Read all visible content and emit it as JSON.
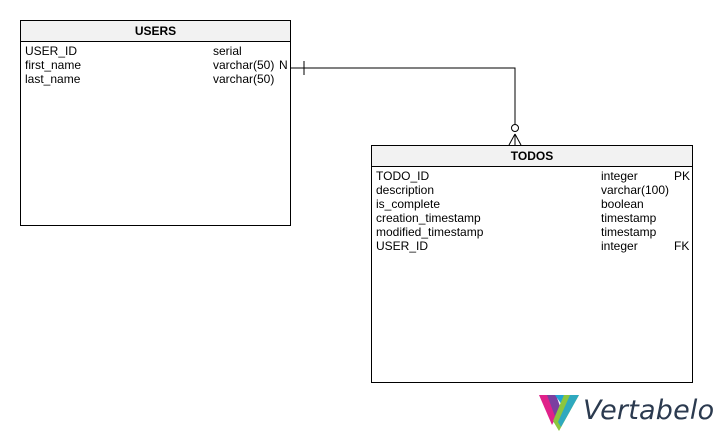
{
  "tables": {
    "users": {
      "title": "USERS",
      "columns": [
        {
          "name": "USER_ID",
          "type": "serial",
          "nullable": "",
          "key": ""
        },
        {
          "name": "first_name",
          "type": "varchar(50)",
          "nullable": "N",
          "key": ""
        },
        {
          "name": "last_name",
          "type": "varchar(50)",
          "nullable": "",
          "key": ""
        }
      ]
    },
    "todos": {
      "title": "TODOS",
      "columns": [
        {
          "name": "TODO_ID",
          "type": "integer",
          "key": "PK"
        },
        {
          "name": "description",
          "type": "varchar(100)",
          "key": ""
        },
        {
          "name": "is_complete",
          "type": "boolean",
          "key": ""
        },
        {
          "name": "creation_timestamp",
          "type": "timestamp",
          "key": ""
        },
        {
          "name": "modified_timestamp",
          "type": "timestamp",
          "key": ""
        },
        {
          "name": "USER_ID",
          "type": "integer",
          "key": "FK"
        }
      ]
    }
  },
  "relationship": {
    "from": "USERS",
    "to": "TODOS",
    "from_end": "one",
    "to_end": "zero-or-many"
  },
  "brand": {
    "name": "Vertabelo",
    "text_color": "#2b3a4f",
    "logo_colors": [
      "#e0218a",
      "#7b3fa0",
      "#1fa3d6",
      "#8cc63f"
    ]
  }
}
